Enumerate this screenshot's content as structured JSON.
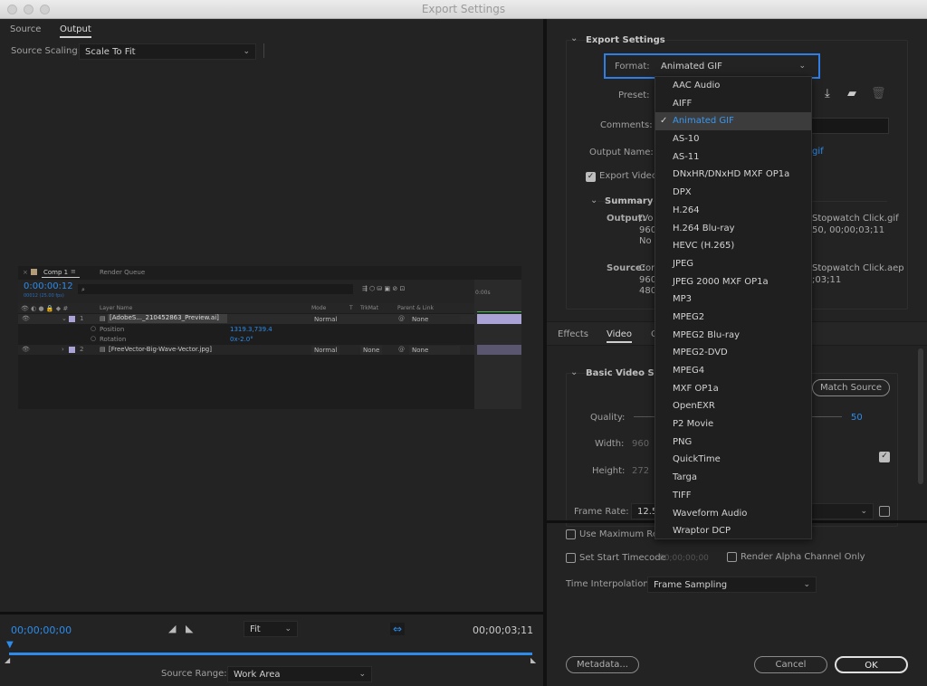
{
  "window": {
    "title": "Export Settings"
  },
  "left": {
    "tabs": [
      {
        "label": "Source"
      },
      {
        "label": "Output",
        "active": true
      }
    ],
    "source_scaling": {
      "label": "Source Scaling:",
      "value": "Scale To Fit"
    },
    "comp": {
      "tab_label": "Comp 1",
      "render_queue_label": "Render Queue",
      "timecode": "0:00:00:12",
      "fps": "00012 (25.00 fps)",
      "columns": {
        "layer_name": "Layer Name",
        "mode": "Mode",
        "t": "T",
        "trkmat": "TrkMat",
        "parent": "Parent & Link"
      },
      "layers": [
        {
          "num": "1",
          "name": "[AdobeS..._210452863_Preview.ai]",
          "mode": "Normal",
          "trkmat": "",
          "parent": "None",
          "expanded": true,
          "props": [
            {
              "name": "Position",
              "value": "1319.3,739.4"
            },
            {
              "name": "Rotation",
              "value": "0x-2.0°"
            }
          ]
        },
        {
          "num": "2",
          "name": "[FreeVector-Big-Wave-Vector.jpg]",
          "mode": "Normal",
          "trkmat": "None",
          "parent": "None",
          "expanded": false
        }
      ],
      "ruler_label": "0:00s"
    },
    "playback": {
      "current_time": "00;00;00;00",
      "end_time": "00;00;03;11",
      "zoom": "Fit",
      "source_range_label": "Source Range:",
      "source_range_value": "Work Area",
      "progress": 0.0
    }
  },
  "right": {
    "export_settings": {
      "section_title": "Export Settings",
      "format_label": "Format:",
      "format_value": "Animated GIF",
      "preset_label": "Preset:",
      "comments_label": "Comments:",
      "output_name_label": "Output Name:",
      "output_name_value_partial": "gif",
      "export_video_label": "Export Video",
      "export_video_checked": true,
      "summary_title": "Summary",
      "output_label": "Output:",
      "output_lines": [
        "/Vo",
        "960",
        "No"
      ],
      "output_lines_right": [
        "Stopwatch Click.gif",
        "50, 00;00;03;11"
      ],
      "source_label": "Source:",
      "source_lines": [
        "Cor",
        "960",
        "480"
      ],
      "source_lines_right": [
        "Stopwatch Click.aep",
        ";03;11"
      ]
    },
    "format_menu": {
      "selected": "Animated GIF",
      "items": [
        "AAC Audio",
        "AIFF",
        "Animated GIF",
        "AS-10",
        "AS-11",
        "DNxHR/DNxHD MXF OP1a",
        "DPX",
        "H.264",
        "H.264 Blu-ray",
        "HEVC (H.265)",
        "JPEG",
        "JPEG 2000 MXF OP1a",
        "MP3",
        "MPEG2",
        "MPEG2 Blu-ray",
        "MPEG2-DVD",
        "MPEG4",
        "MXF OP1a",
        "OpenEXR",
        "P2 Movie",
        "PNG",
        "QuickTime",
        "Targa",
        "TIFF",
        "Waveform Audio",
        "Wraptor DCP"
      ]
    },
    "tabs": [
      {
        "label": "Effects"
      },
      {
        "label": "Video",
        "active": true
      },
      {
        "label": "C"
      }
    ],
    "video": {
      "section_title": "Basic Video Setti",
      "match_source": "Match Source",
      "quality_label": "Quality:",
      "quality_value": "50",
      "width_label": "Width:",
      "width_value": "960",
      "height_label": "Height:",
      "height_value": "272",
      "frame_rate_label": "Frame Rate:",
      "frame_rate_value": "12.5"
    },
    "bottom": {
      "use_max_render_label": "Use Maximum Ren",
      "set_start_timecode_label": "Set Start Timecode",
      "start_timecode_value": "00;00;00;00",
      "render_alpha_label": "Render Alpha Channel Only",
      "time_interp_label": "Time Interpolation:",
      "time_interp_value": "Frame Sampling",
      "metadata_btn": "Metadata...",
      "cancel_btn": "Cancel",
      "ok_btn": "OK"
    }
  },
  "colors": {
    "accent": "#2d8ceb",
    "focus_ring": "#2f7ee6",
    "selected_item_bg": "#3c3c3c"
  }
}
